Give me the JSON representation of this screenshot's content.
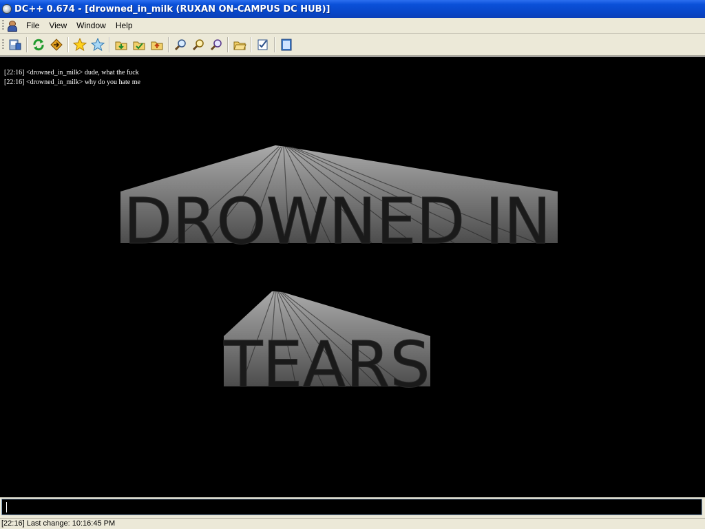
{
  "window": {
    "title": "DC++ 0.674 - [drowned_in_milk (RUXAN ON-CAMPUS DC HUB)]"
  },
  "menu": {
    "items": [
      {
        "label": "File"
      },
      {
        "label": "View"
      },
      {
        "label": "Window"
      },
      {
        "label": "Help"
      }
    ]
  },
  "toolbar": {
    "buttons": [
      {
        "icon": "connect-hub-icon"
      },
      {
        "icon": "reconnect-icon"
      },
      {
        "icon": "follow-redirect-icon"
      },
      {
        "icon": "favorite-hubs-icon"
      },
      {
        "icon": "favorite-users-icon"
      },
      {
        "icon": "download-queue-icon"
      },
      {
        "icon": "finished-downloads-icon"
      },
      {
        "icon": "finished-uploads-icon"
      },
      {
        "icon": "search-icon"
      },
      {
        "icon": "adl-search-icon"
      },
      {
        "icon": "search-spy-icon"
      },
      {
        "icon": "open-file-list-icon"
      },
      {
        "icon": "settings-icon"
      },
      {
        "icon": "notepad-icon"
      }
    ]
  },
  "chat": {
    "lines": [
      {
        "text": "[22:16] <drowned_in_milk> dude, what the fuck"
      },
      {
        "text": "[22:16] <drowned_in_milk> why do you hate me"
      }
    ],
    "art": {
      "line1": "DROWNED IN",
      "line2": "TEARS"
    }
  },
  "input": {
    "value": ""
  },
  "status": {
    "text": "[22:16] Last change: 10:16:45 PM"
  }
}
